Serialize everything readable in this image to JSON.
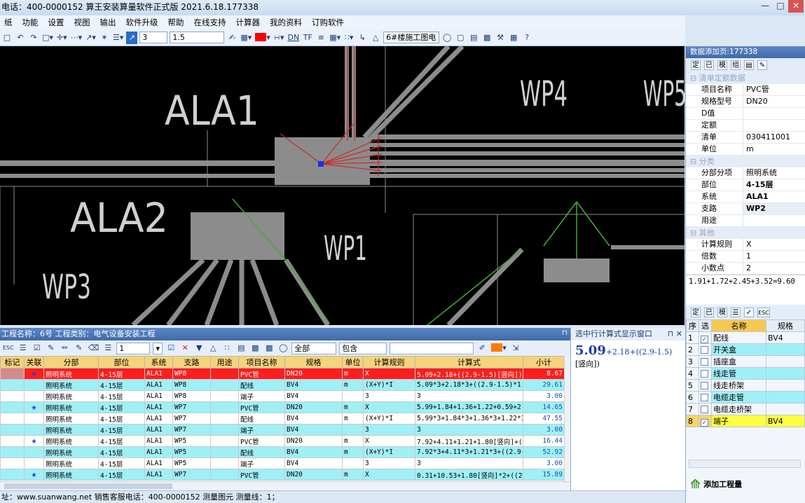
{
  "title": "电话：400-0000152  算王安装算量软件正式版 2021.6.18.177338",
  "menus": [
    "纸",
    "功能",
    "设置",
    "视图",
    "输出",
    "软件升级",
    "帮助",
    "在线支持",
    "计算器",
    "我的资料",
    "订购软件"
  ],
  "toolbar": {
    "layer_value": "3",
    "linewidth_value": "1.5",
    "dn_label": "DN",
    "drawing_select": "6#楼施工图电"
  },
  "canvas_labels": {
    "ala1": "ALA1",
    "ala2": "ALA2",
    "wp1": "WP1",
    "wp3": "WP3",
    "wp4": "WP4",
    "wp5": "WP5"
  },
  "right_panel": {
    "header": "数据添加页:177338",
    "section_list": "清单定额数据",
    "section_class": "分类",
    "section_other": "其他",
    "props": [
      {
        "k": "项目名称",
        "v": "PVC管"
      },
      {
        "k": "规格型号",
        "v": "DN20"
      },
      {
        "k": "D值",
        "v": ""
      },
      {
        "k": "定额",
        "v": ""
      },
      {
        "k": "清单",
        "v": "030411001"
      },
      {
        "k": "单位",
        "v": "m"
      }
    ],
    "class_props": [
      {
        "k": "分部分项",
        "v": "照明系统"
      },
      {
        "k": "部位",
        "v": "4-15层"
      },
      {
        "k": "系统",
        "v": "ALA1"
      },
      {
        "k": "支路",
        "v": "WP2"
      },
      {
        "k": "用途",
        "v": ""
      }
    ],
    "other_props": [
      {
        "k": "计算规则",
        "v": "X"
      },
      {
        "k": "倍数",
        "v": "1"
      },
      {
        "k": "小数点",
        "v": "2"
      }
    ],
    "formula": "1.91+1.72+2.45+3.52=9.60",
    "sel_headers": [
      "序",
      "选",
      "名称",
      "规格"
    ],
    "sel_rows": [
      {
        "n": "1",
        "c": true,
        "name": "配线",
        "spec": "BV4"
      },
      {
        "n": "2",
        "c": false,
        "name": "开关盒",
        "spec": ""
      },
      {
        "n": "3",
        "c": false,
        "name": "插座盒",
        "spec": ""
      },
      {
        "n": "4",
        "c": false,
        "name": "线走管",
        "spec": ""
      },
      {
        "n": "5",
        "c": false,
        "name": "线走桥架",
        "spec": ""
      },
      {
        "n": "6",
        "c": false,
        "name": "电缆走管",
        "spec": ""
      },
      {
        "n": "7",
        "c": false,
        "name": "电缆走桥架",
        "spec": ""
      },
      {
        "n": "8",
        "c": true,
        "name": "端子",
        "spec": "BV4"
      }
    ],
    "add_button": "添加工程量"
  },
  "project_bar": "工程名称：6号 工程类别：电气设备安装工程",
  "grid_tool": {
    "count": "1",
    "filter1": "全部",
    "filter2": "包含"
  },
  "grid_headers": [
    "标记",
    "关联",
    "分部",
    "部位",
    "系统",
    "支路",
    "用途",
    "项目名称",
    "规格",
    "单位",
    "计算规则",
    "计算式",
    "小计"
  ],
  "grid_rows": [
    {
      "star": true,
      "fb": "照明系统",
      "bw": "4-15层",
      "xt": "ALA1",
      "zl": "WP8",
      "yt": "",
      "mc": "PVC管",
      "gg": "DN20",
      "dw": "m",
      "gz": "X",
      "js": "5.09+2.18+((2.9-1.5)[竖向])",
      "xj": "8.67",
      "s": "hl"
    },
    {
      "star": false,
      "fb": "照明系统",
      "bw": "4-15层",
      "xt": "ALA1",
      "zl": "WP8",
      "yt": "",
      "mc": "配线",
      "gg": "BV4",
      "dw": "m",
      "gz": "(X+Y)*I",
      "js": "5.09*3+2.18*3+((2.9-1.5)*1.",
      "xj": "29.61",
      "s": "cy"
    },
    {
      "star": false,
      "fb": "照明系统",
      "bw": "4-15层",
      "xt": "ALA1",
      "zl": "WP8",
      "yt": "",
      "mc": "端子",
      "gg": "BV4",
      "dw": "",
      "gz": "3",
      "js": "3",
      "xj": "3.00",
      "s": "wh"
    },
    {
      "star": true,
      "fb": "照明系统",
      "bw": "4-15层",
      "xt": "ALA1",
      "zl": "WP7",
      "yt": "",
      "mc": "PVC管",
      "gg": "DN20",
      "dw": "m",
      "gz": "X",
      "js": "5.99+1.84+1.36+1.22+0.59+2.2",
      "xj": "14.65",
      "s": "cy"
    },
    {
      "star": false,
      "fb": "照明系统",
      "bw": "4-15层",
      "xt": "ALA1",
      "zl": "WP7",
      "yt": "",
      "mc": "配线",
      "gg": "BV4",
      "dw": "m",
      "gz": "(X+Y)*I",
      "js": "5.99*3+1.84*3+1.36*3+1.22*3+",
      "xj": "47.55",
      "s": "wh"
    },
    {
      "star": false,
      "fb": "照明系统",
      "bw": "4-15层",
      "xt": "ALA1",
      "zl": "WP7",
      "yt": "",
      "mc": "端子",
      "gg": "BV4",
      "dw": "",
      "gz": "3",
      "js": "3",
      "xj": "3.00",
      "s": "cy"
    },
    {
      "star": true,
      "fb": "照明系统",
      "bw": "4-15层",
      "xt": "ALA1",
      "zl": "WP5",
      "yt": "",
      "mc": "PVC管",
      "gg": "DN20",
      "dw": "m",
      "gz": "X",
      "js": "7.92+4.11+1.21+1.80[竖向]+((",
      "xj": "16.44",
      "s": "wh"
    },
    {
      "star": false,
      "fb": "照明系统",
      "bw": "4-15层",
      "xt": "ALA1",
      "zl": "WP5",
      "yt": "",
      "mc": "配线",
      "gg": "BV4",
      "dw": "m",
      "gz": "(X+Y)*I",
      "js": "7.92*3+4.11*3+1.21*3+((2.9-",
      "xj": "52.92",
      "s": "cy"
    },
    {
      "star": false,
      "fb": "照明系统",
      "bw": "4-15层",
      "xt": "ALA1",
      "zl": "WP5",
      "yt": "",
      "mc": "端子",
      "gg": "BV4",
      "dw": "",
      "gz": "3",
      "js": "3",
      "xj": "3.00",
      "s": "wh"
    },
    {
      "star": true,
      "fb": "照明系统",
      "bw": "4-15层",
      "xt": "ALA1",
      "zl": "WP7",
      "yt": "",
      "mc": "PVC管",
      "gg": "DN20",
      "dw": "m",
      "gz": "X",
      "js": "0.31+10.53+1.80[竖向]*2+((2.",
      "xj": "15.89",
      "s": "cy"
    }
  ],
  "calc_window": {
    "title": "选中行计算式显示窗口",
    "big": "5.09",
    "rest": "+2.18+((2.9-1.5)",
    "line2": "[竖向])"
  },
  "status": "址：www.suanwang.net 销售客服电话：400-0000152  测量图元 测量线：1；"
}
